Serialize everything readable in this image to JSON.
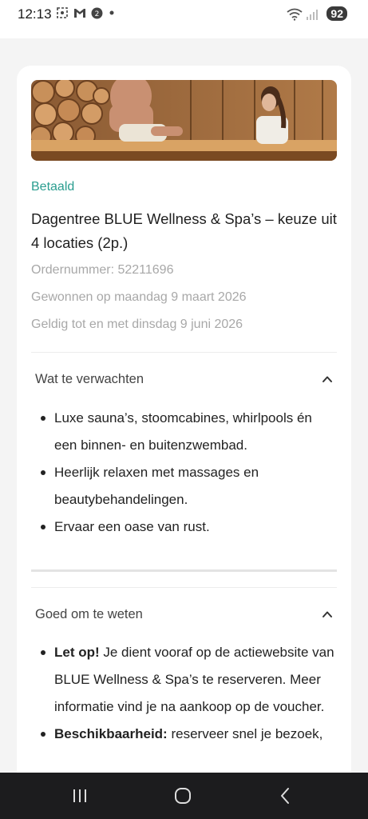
{
  "status_bar": {
    "time": "12:13",
    "battery": "92",
    "icons": [
      "screen-record-icon",
      "gmail-icon",
      "notification-badge-icon",
      "dot-icon",
      "wifi-icon",
      "signal-icon"
    ]
  },
  "order": {
    "status": "Betaald",
    "title": "Dagentree BLUE Wellness & Spa’s – keuze uit 4 locaties (2p.)",
    "order_number": "Ordernummer: 52211696",
    "won_on": "Gewonnen op maandag 9 maart 2026",
    "valid_until": "Geldig tot en met dinsdag 9 juni 2026"
  },
  "sections": {
    "expect": {
      "title": "Wat te verwachten",
      "items": [
        "Luxe sauna’s, stoomcabines, whirlpools én een binnen- en buitenzwembad.",
        "Heerlijk relaxen met massages en beautybehandelingen.",
        "Ervaar een oase van rust."
      ]
    },
    "good_to_know": {
      "title": "Goed om te weten",
      "items": [
        {
          "bold": "Let op!",
          "text": " Je dient vooraf op de actiewebsite van BLUE Wellness & Spa’s te reserveren. Meer informatie vind je na aankoop op de voucher."
        },
        {
          "bold": "Beschikbaarheid:",
          "text": " reserveer snel je bezoek,"
        }
      ]
    }
  },
  "colors": {
    "accent": "#2a9d8f",
    "muted_text": "#a8a8a8",
    "nav_bar": "#1c1c1e"
  }
}
